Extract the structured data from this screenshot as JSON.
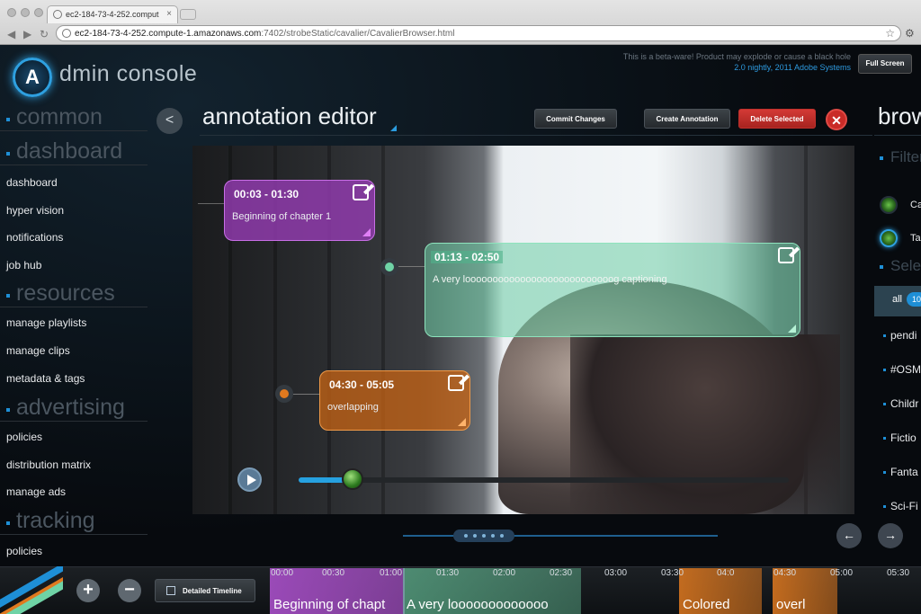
{
  "browser": {
    "tab_title": "ec2-184-73-4-252.comput",
    "url_host": "ec2-184-73-4-252.compute-1.amazonaws.com",
    "url_path": ":7402/strobeStatic/cavalier/CavalierBrowser.html"
  },
  "app": {
    "logo_letter": "A",
    "logo_text": "dmin console",
    "beta_notice": "This is a beta-ware! Product may explode or cause a black hole",
    "version": "2.0 nightly, 2011 Adobe Systems",
    "fullscreen_label": "Full Screen"
  },
  "sidebar": {
    "sections": [
      {
        "title": "common",
        "items": []
      },
      {
        "title": "dashboard",
        "items": [
          "dashboard",
          "hyper vision",
          "notifications",
          "job hub"
        ]
      },
      {
        "title": "resources",
        "items": [
          "manage playlists",
          "manage clips",
          "metadata & tags"
        ]
      },
      {
        "title": "advertising",
        "items": [
          "policies",
          "distribution matrix",
          "manage ads"
        ]
      },
      {
        "title": "tracking",
        "items": [
          "policies"
        ]
      }
    ]
  },
  "editor": {
    "back_label": "<",
    "title": "annotation editor",
    "commit_label": "Commit Changes",
    "create_label": "Create Annotation",
    "delete_label": "Delete Selected",
    "close_label": "✕",
    "playback_progress": 0.11
  },
  "annotations": [
    {
      "time": "00:03  -  01:30",
      "text": "Beginning of chapter 1",
      "color": "#a84fc8"
    },
    {
      "time": "01:13  -  02:50",
      "text": "A very looooooooooooooooooooooooooog captioning",
      "color": "#6fd3a6"
    },
    {
      "time": "04:30  -  05:05",
      "text": "overlapping",
      "color": "#e0791f"
    }
  ],
  "browse": {
    "title": "brow",
    "filter_label": "Filter",
    "radio_items": [
      "Ca",
      "Ta"
    ],
    "select_label": "Sele",
    "all_label": "all",
    "all_count": "10",
    "items": [
      "pendi",
      "#OSM",
      "Childr",
      "Fictio",
      "Fanta",
      "Sci-Fi"
    ]
  },
  "timeline": {
    "detailed_label": "Detailed Timeline",
    "ticks": [
      "00:00",
      "00:30",
      "01:00",
      "01:30",
      "02:00",
      "02:30",
      "03:00",
      "03:30",
      "04:0",
      "04:30",
      "05:00",
      "05:30"
    ],
    "segments": [
      {
        "label": "Beginning of chapt",
        "color": "#a84fc8"
      },
      {
        "label": "A very looooooooooooo",
        "color": "#6fd3a6"
      },
      {
        "label": "Colored",
        "color": "#e0791f"
      },
      {
        "label": "overl",
        "color": "#e0791f"
      }
    ]
  }
}
